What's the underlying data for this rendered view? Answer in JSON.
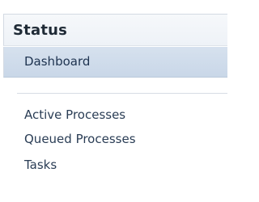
{
  "panel": {
    "title": "Status"
  },
  "nav": {
    "selected": "Dashboard",
    "items": [
      "Active Processes",
      "Queued Processes",
      "Tasks"
    ]
  },
  "colors": {
    "selected_background": "#cfdbeb",
    "link_text": "#2a3d55",
    "title_text": "#1f2a36"
  }
}
